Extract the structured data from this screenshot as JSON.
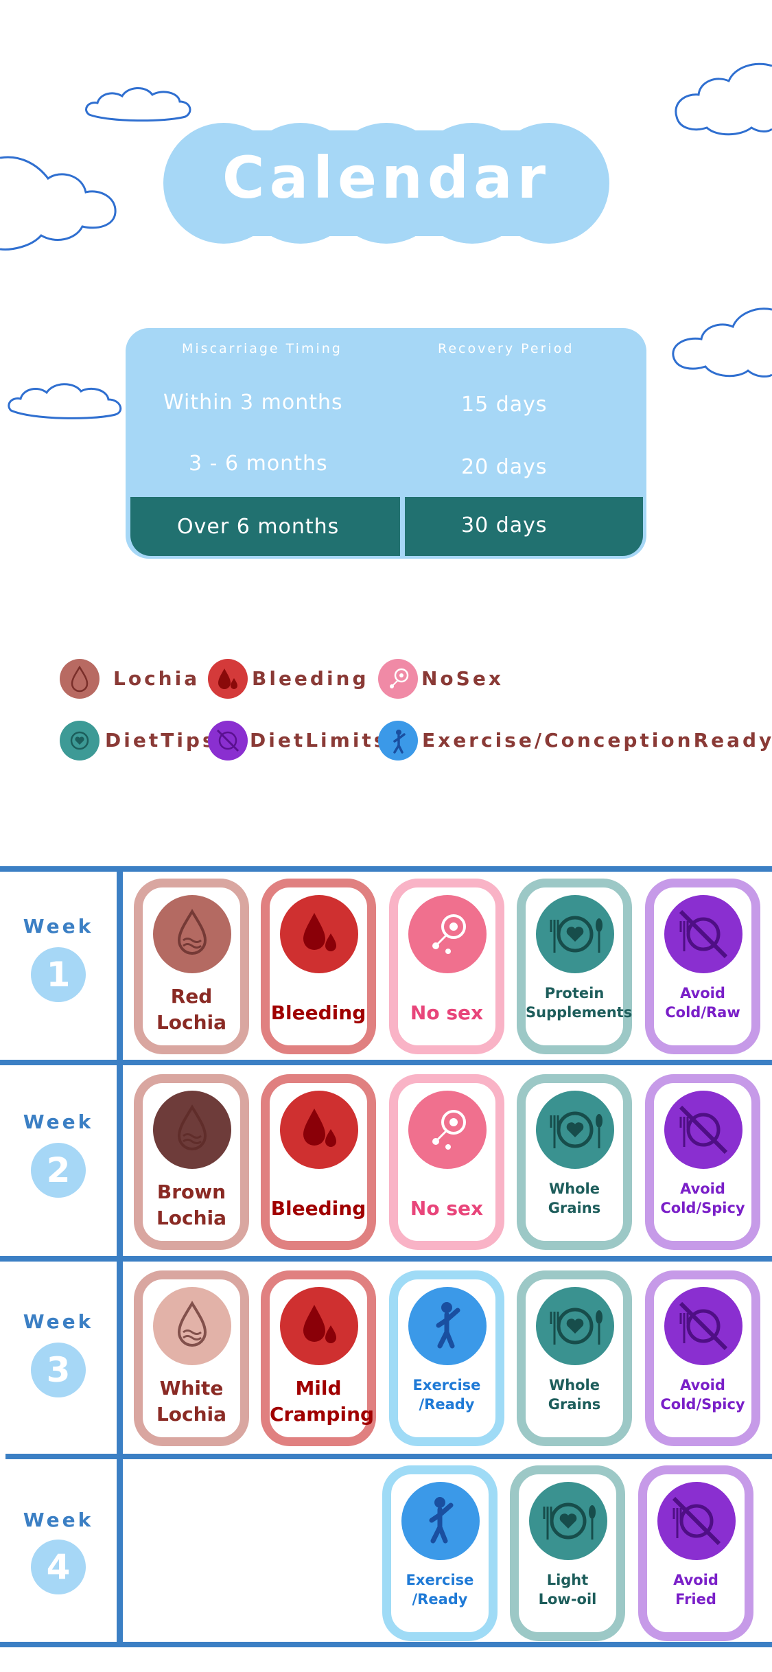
{
  "title": "Calendar",
  "recovery_table": {
    "headers": [
      "Miscarriage Timing",
      "Recovery Period"
    ],
    "rows": [
      {
        "timing": "Within 3 months",
        "period": "15 days"
      },
      {
        "timing": "3 - 6 months",
        "period": "20 days"
      },
      {
        "timing": "Over 6 months",
        "period": "30 days"
      }
    ]
  },
  "legend": {
    "lochia": "Lochia",
    "bleeding": "Bleeding",
    "nosex": "NoSex",
    "diettips": "DietTips",
    "dietlimits": "DietLimits",
    "exercise": "Exercise/ConceptionReady"
  },
  "weeks": [
    {
      "label": "Week",
      "number": "1"
    },
    {
      "label": "Week",
      "number": "2"
    },
    {
      "label": "Week",
      "number": "3"
    },
    {
      "label": "Week",
      "number": "4"
    }
  ],
  "cards": {
    "w1": [
      {
        "line1": "Red",
        "line2": "Lochia",
        "icon": "lochia-drop-icon"
      },
      {
        "line1": "Bleeding",
        "line2": "",
        "icon": "blood-drops-icon"
      },
      {
        "line1": "No sex",
        "line2": "",
        "icon": "no-sex-icon"
      },
      {
        "line1": "Protein",
        "line2": "Supplements",
        "icon": "plate-heart-icon"
      },
      {
        "line1": "Avoid",
        "line2": "Cold/Raw",
        "icon": "no-food-icon"
      }
    ],
    "w2": [
      {
        "line1": "Brown",
        "line2": "Lochia",
        "icon": "lochia-drop-icon"
      },
      {
        "line1": "Bleeding",
        "line2": "",
        "icon": "blood-drops-icon"
      },
      {
        "line1": "No sex",
        "line2": "",
        "icon": "no-sex-icon"
      },
      {
        "line1": "Whole",
        "line2": "Grains",
        "icon": "plate-heart-icon"
      },
      {
        "line1": "Avoid",
        "line2": "Cold/Spicy",
        "icon": "no-food-icon"
      }
    ],
    "w3": [
      {
        "line1": "White",
        "line2": "Lochia",
        "icon": "lochia-drop-icon"
      },
      {
        "line1": "Mild",
        "line2": "Cramping",
        "icon": "blood-drops-icon"
      },
      {
        "line1": "Exercise",
        "line2": "/Ready",
        "icon": "exercise-icon"
      },
      {
        "line1": "Whole",
        "line2": "Grains",
        "icon": "plate-heart-icon"
      },
      {
        "line1": "Avoid",
        "line2": "Cold/Spicy",
        "icon": "no-food-icon"
      }
    ],
    "w4": [
      {
        "line1": "Exercise",
        "line2": "/Ready",
        "icon": "exercise-icon"
      },
      {
        "line1": "Light",
        "line2": "Low-oil",
        "icon": "plate-heart-icon"
      },
      {
        "line1": "Avoid",
        "line2": "Fried",
        "icon": "no-food-icon"
      }
    ]
  },
  "colors": {
    "sky_blue": "#a6d7f6",
    "teal_dark": "#217170",
    "grid_blue": "#3b7fc4",
    "legend_text": "#8a3a36"
  }
}
